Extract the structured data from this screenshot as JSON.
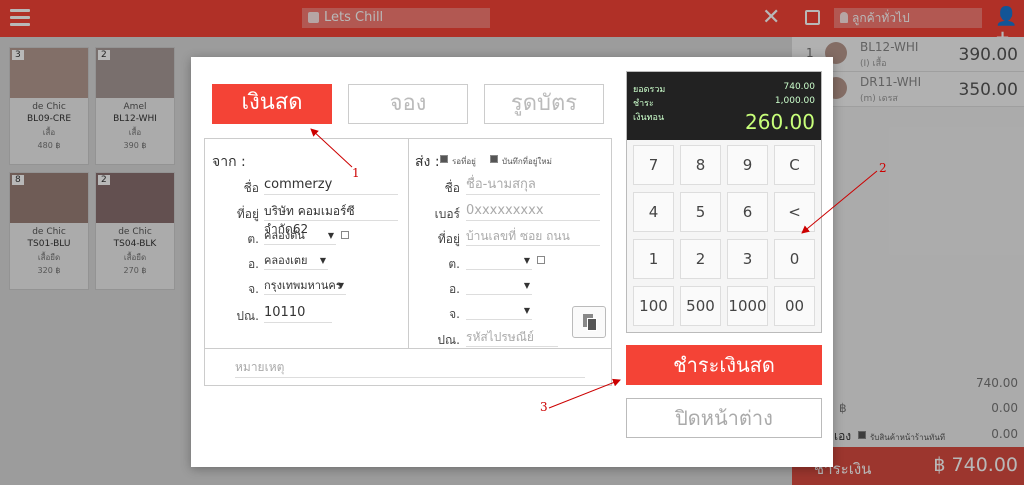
{
  "header": {
    "title": "Lets Chill",
    "customer_placeholder": "ลูกค้าทั่วไป"
  },
  "products": [
    {
      "badge": "3",
      "brand": "de Chic",
      "code": "BL09-CRE",
      "category": "เสื้อ",
      "price": "480 ฿"
    },
    {
      "badge": "2",
      "brand": "Amel",
      "code": "BL12-WHI",
      "category": "เสื้อ",
      "price": "390 ฿"
    },
    {
      "badge": "8",
      "brand": "de Chic",
      "code": "TS01-BLU",
      "category": "เสื้อยืด",
      "price": "320 ฿"
    },
    {
      "badge": "2",
      "brand": "de Chic",
      "code": "TS04-BLK",
      "category": "เสื้อยืด",
      "price": "270 ฿"
    }
  ],
  "cart": {
    "items": [
      {
        "qty": "1",
        "name": "BL12-WHI",
        "sub": "(I) เสื้อ",
        "amount": "390.00"
      },
      {
        "qty": "1",
        "name": "DR11-WHI",
        "sub": "(m) เดรส",
        "amount": "350.00"
      }
    ],
    "subtotal": "740.00",
    "discount_symbol": "฿",
    "discount": "0.00",
    "shipping_label": "เอง",
    "shipping_note": "รับสินค้าหน้าร้านทันที",
    "shipping": "0.00",
    "pay_label": "ชำระเงิน",
    "total": "฿ 740.00"
  },
  "modal": {
    "tabs": {
      "cash": "เงินสด",
      "reserve": "จอง",
      "card": "รูดบัตร"
    },
    "from": {
      "title": "จาก :",
      "name_label": "ชื่อ",
      "name": "commerzy",
      "address_label": "ที่อยู่",
      "address": "บริษัท คอมเมอร์ซี จำกัด62",
      "subdistrict_label": "ต.",
      "subdistrict": "คลองตัน",
      "district_label": "อ.",
      "district": "คลองเตย",
      "province_label": "จ.",
      "province": "กรุงเทพมหานคร",
      "zip_label": "ปณ.",
      "zip": "10110"
    },
    "to": {
      "title": "ส่ง :",
      "wait_label": "รอที่อยู่",
      "save_label": "บันทึกที่อยู่ใหม่",
      "name_label": "ชื่อ",
      "name_placeholder": "ชื่อ-นามสกุล",
      "phone_label": "เบอร์",
      "phone_placeholder": "0xxxxxxxxx",
      "address_label": "ที่อยู่",
      "address_placeholder": "บ้านเลขที่ ซอย ถนน",
      "subdistrict_label": "ต.",
      "district_label": "อ.",
      "province_label": "จ.",
      "zip_label": "ปณ.",
      "zip_placeholder": "รหัสไปรษณีย์"
    },
    "note_placeholder": "หมายเหตุ",
    "calculator": {
      "total_label": "ยอดรวม",
      "total": "740.00",
      "paid_label": "ชำระ",
      "paid": "1,000.00",
      "change_label": "เงินทอน",
      "change": "260.00",
      "keys": [
        "7",
        "8",
        "9",
        "C",
        "4",
        "5",
        "6",
        "<",
        "1",
        "2",
        "3",
        "0",
        "100",
        "500",
        "1000",
        "00"
      ]
    },
    "pay_button": "ชำระเงินสด",
    "close_button": "ปิดหน้าต่าง"
  },
  "annotations": [
    "1",
    "2",
    "3"
  ]
}
